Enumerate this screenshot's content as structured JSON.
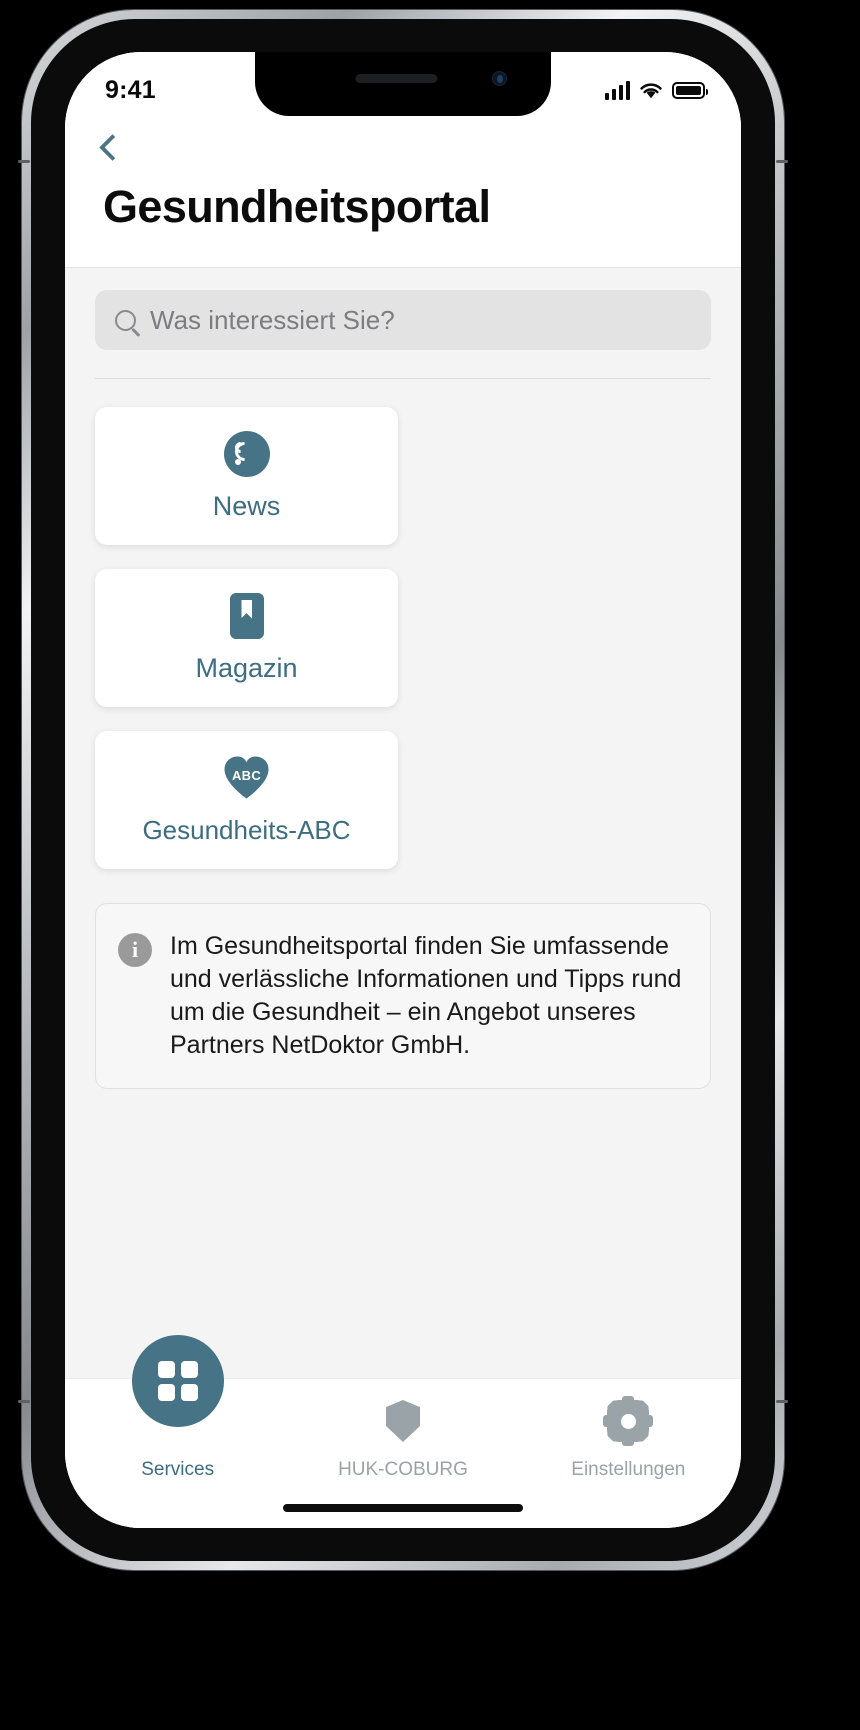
{
  "status_bar": {
    "time": "9:41",
    "signal_icon": "cellular-signal-icon",
    "wifi_icon": "wifi-icon",
    "battery_icon": "battery-full-icon"
  },
  "header": {
    "back_icon": "chevron-left-icon",
    "title": "Gesundheitsportal"
  },
  "search": {
    "icon": "search-icon",
    "placeholder": "Was interessiert Sie?",
    "value": ""
  },
  "tiles": [
    {
      "label": "News",
      "icon": "rss-feed-icon"
    },
    {
      "label": "Magazin",
      "icon": "bookmark-book-icon"
    },
    {
      "label": "Gesundheits-ABC",
      "icon": "heart-abc-icon",
      "icon_text": "ABC"
    }
  ],
  "info_box": {
    "icon": "info-icon",
    "icon_glyph": "i",
    "text": "Im Gesundheitsportal finden Sie umfassende und verlässliche Informationen und Tipps rund um die Gesundheit – ein Angebot unseres Partners NetDoktor GmbH."
  },
  "tab_bar": {
    "items": [
      {
        "label": "Services",
        "icon": "grid-apps-icon",
        "active": true
      },
      {
        "label": "HUK-COBURG",
        "icon": "shield-icon",
        "active": false
      },
      {
        "label": "Einstellungen",
        "icon": "gear-icon",
        "active": false
      }
    ]
  },
  "colors": {
    "accent": "#467386",
    "accent_text": "#3d6d80",
    "inactive": "#9aa3a8",
    "page_bg": "#f4f4f4",
    "card_bg": "#ffffff"
  }
}
